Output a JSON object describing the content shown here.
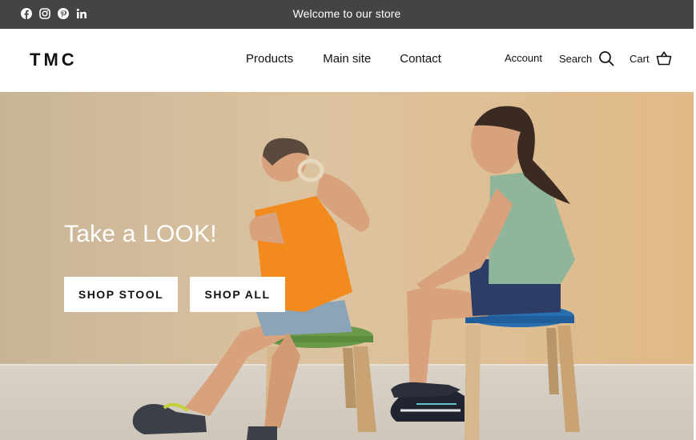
{
  "announcement": {
    "message": "Welcome to our store",
    "social_icons": [
      "facebook-icon",
      "instagram-icon",
      "pinterest-icon",
      "linkedin-icon"
    ]
  },
  "header": {
    "logo": "TMC",
    "nav": [
      "Products",
      "Main site",
      "Contact"
    ],
    "account_label": "Account",
    "search_label": "Search",
    "cart_label": "Cart"
  },
  "hero": {
    "title": "Take a LOOK!",
    "buttons": [
      "SHOP STOOL",
      "SHOP ALL"
    ]
  },
  "colors": {
    "announcement_bg": "#444444",
    "wall": "#d8bc96",
    "floor": "#d8d1c8",
    "stool_green": "#6a9a48",
    "stool_blue": "#2a6fb0",
    "shirt_orange": "#f28a1e",
    "shirt_sage": "#8fb59a"
  }
}
